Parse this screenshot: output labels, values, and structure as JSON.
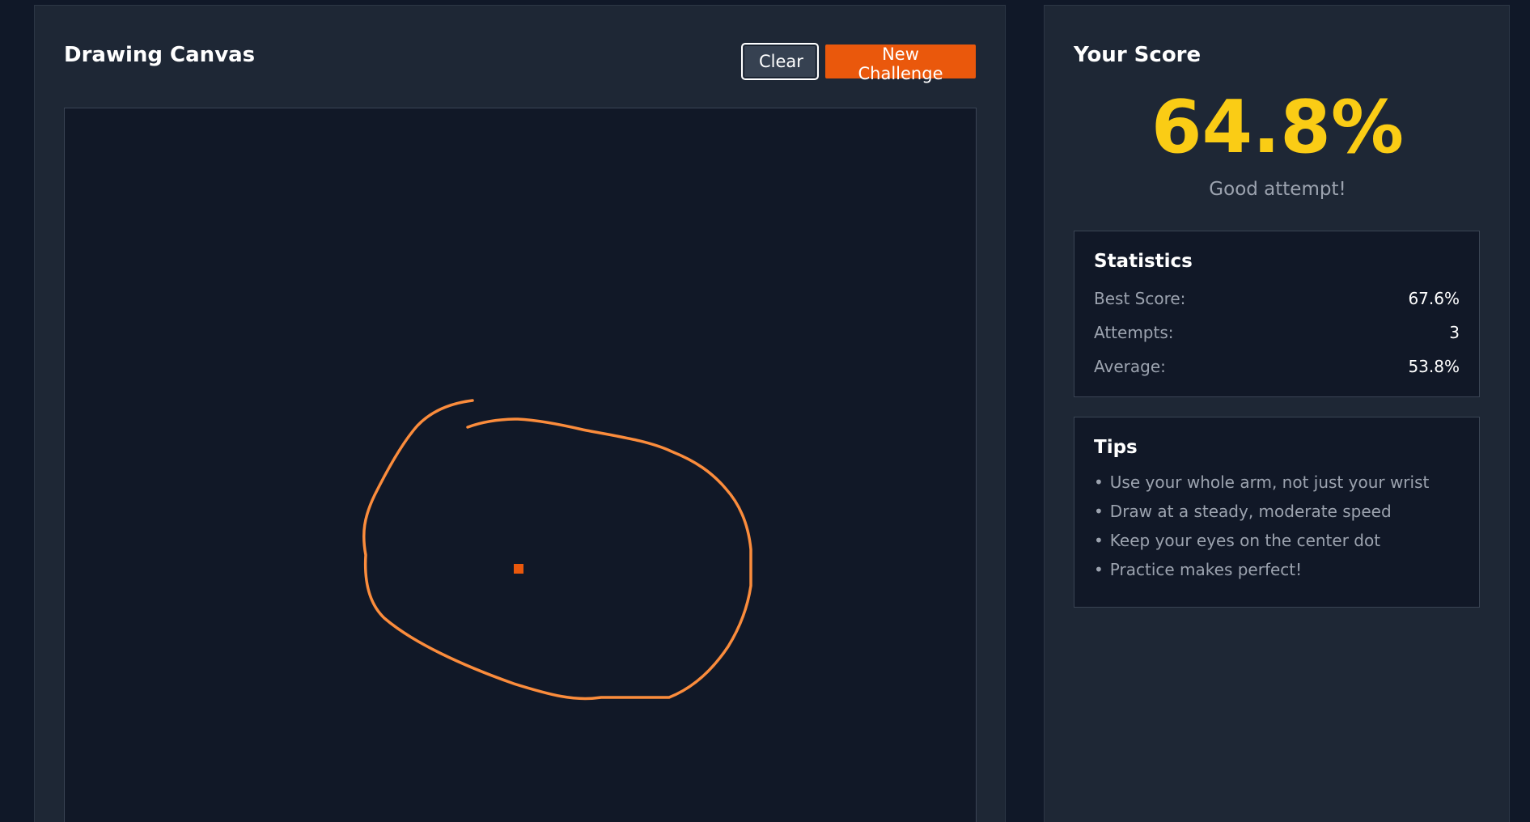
{
  "canvas_panel": {
    "title": "Drawing Canvas",
    "clear_label": "Clear",
    "new_challenge_label": "New Challenge",
    "stroke_color": "#fb8c3c",
    "center_dot_color": "#ea580c"
  },
  "score_panel": {
    "title": "Your Score",
    "score": "64.8%",
    "message": "Good attempt!",
    "score_color": "#facc15"
  },
  "statistics": {
    "title": "Statistics",
    "rows": [
      {
        "label": "Best Score:",
        "value": "67.6%"
      },
      {
        "label": "Attempts:",
        "value": "3"
      },
      {
        "label": "Average:",
        "value": "53.8%"
      }
    ]
  },
  "tips": {
    "title": "Tips",
    "items": [
      "Use your whole arm, not just your wrist",
      "Draw at a steady, moderate speed",
      "Keep your eyes on the center dot",
      "Practice makes perfect!"
    ]
  },
  "accent_color": "#ea580c"
}
